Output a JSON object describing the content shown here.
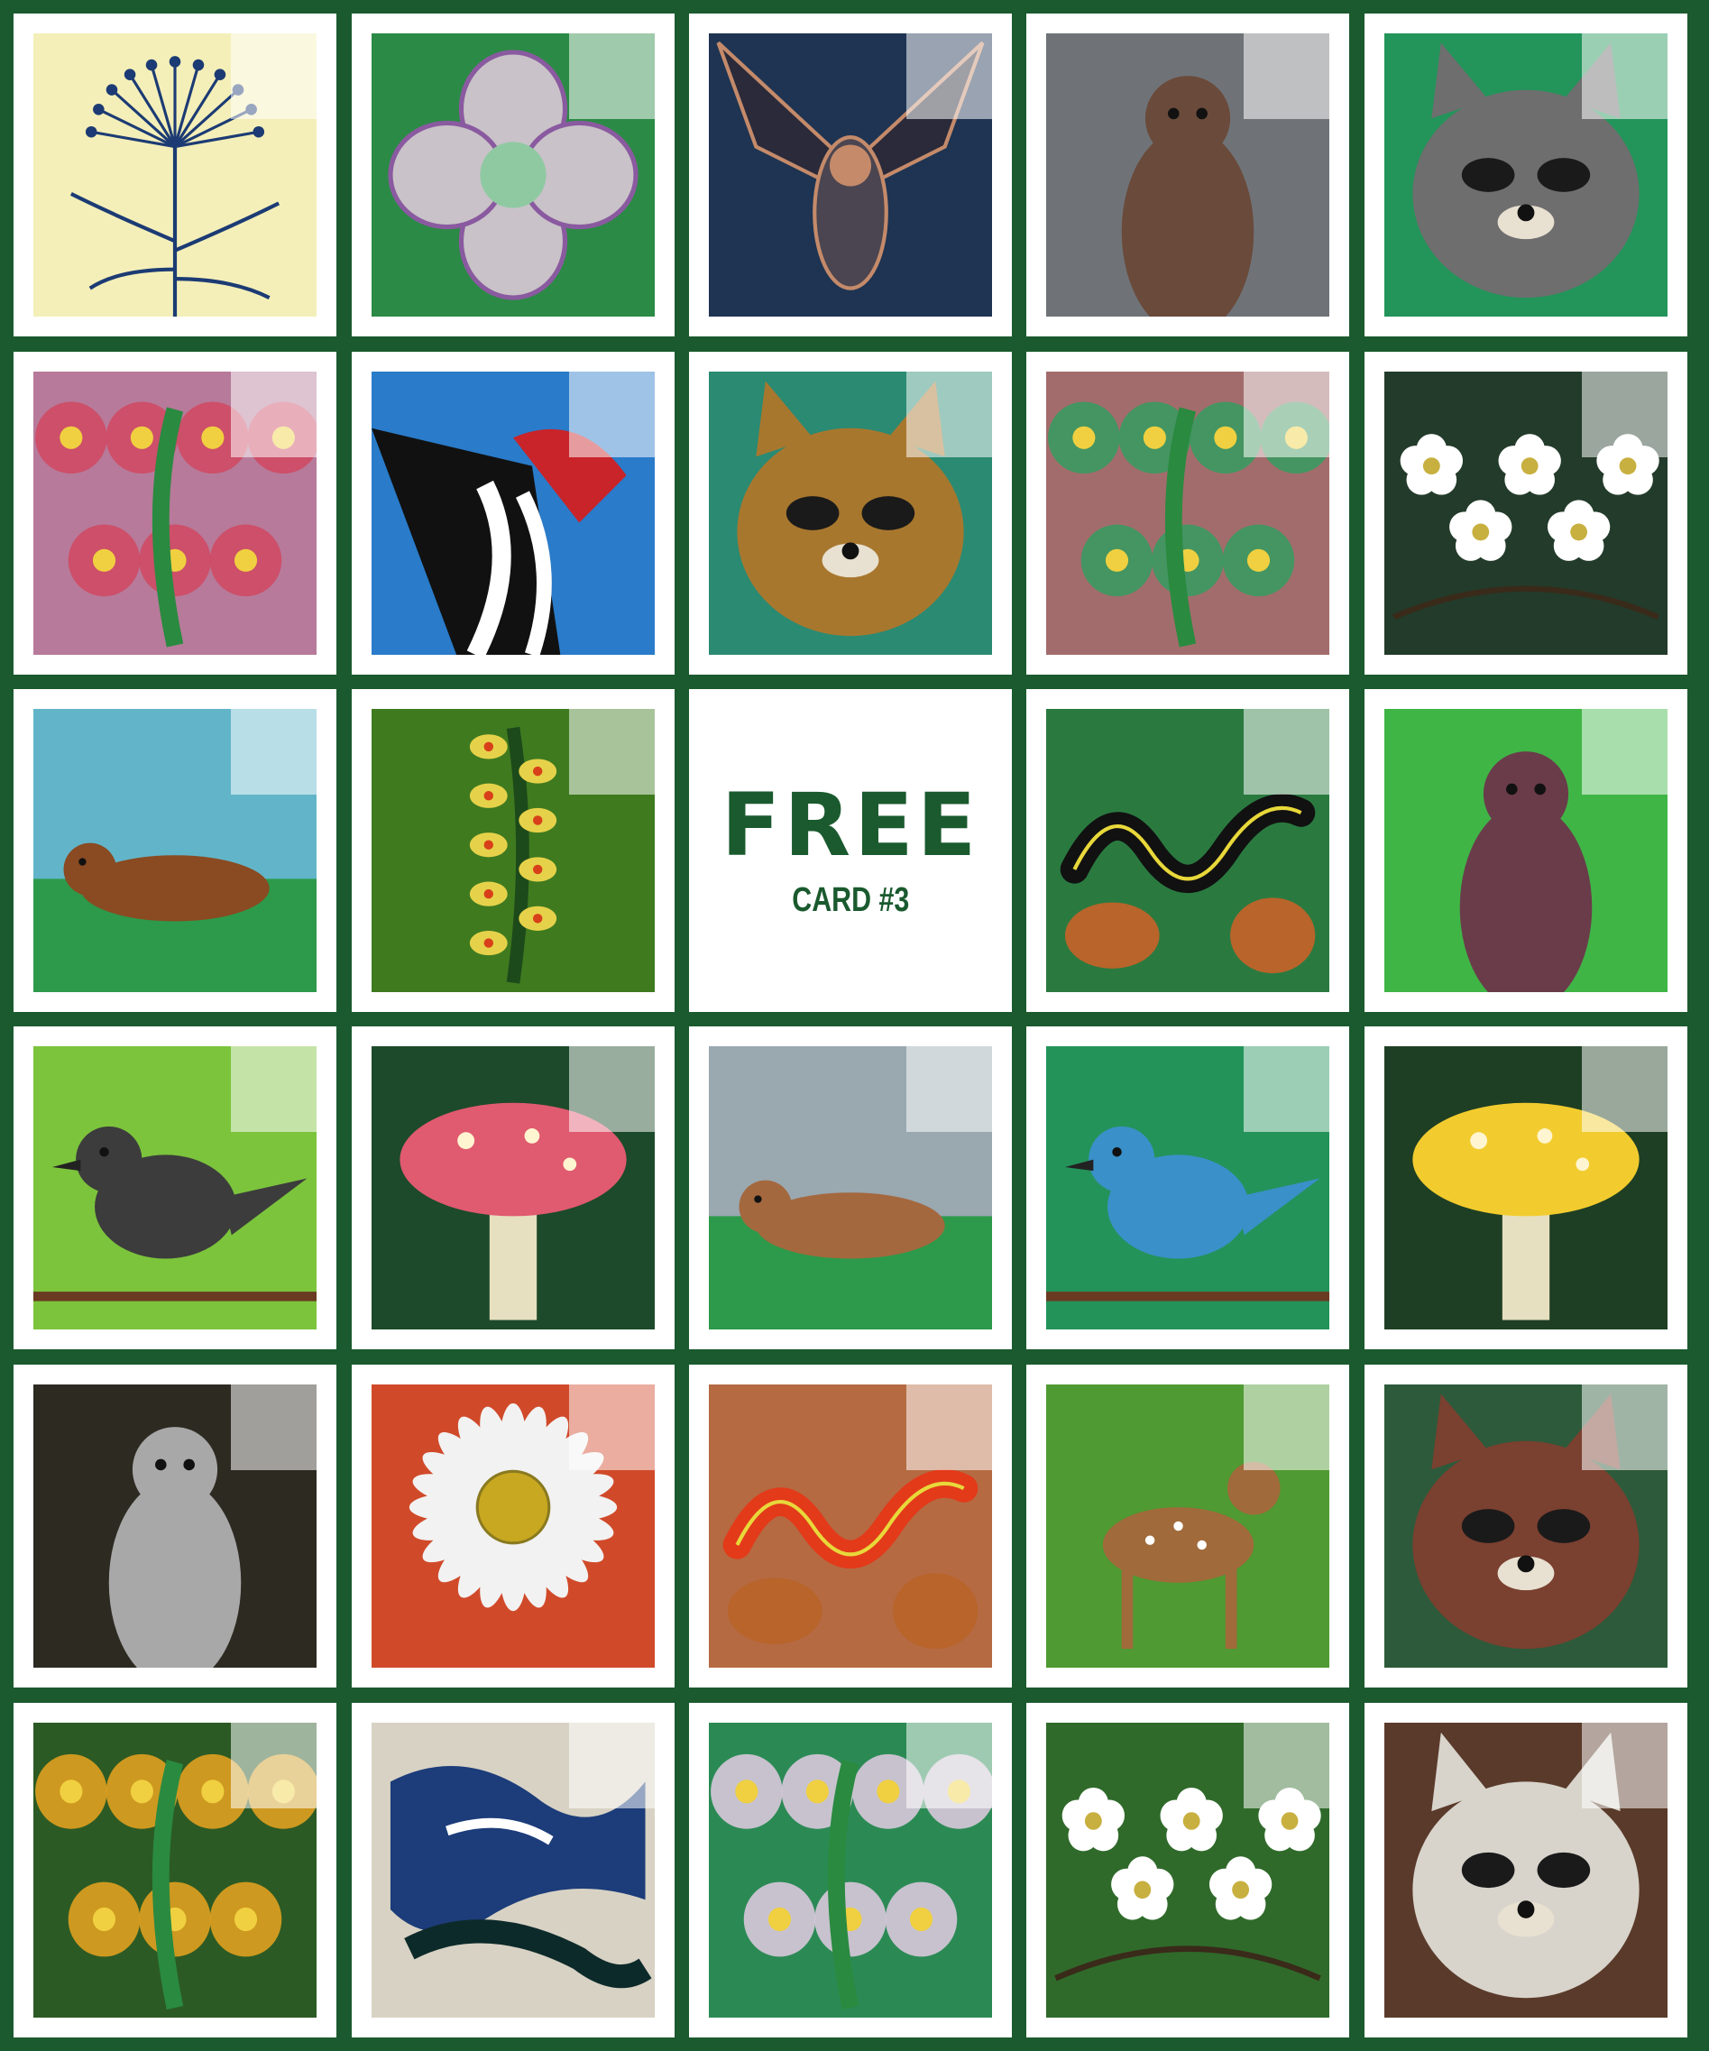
{
  "free_cell": {
    "title": "FREE",
    "subtitle": "CARD #3"
  },
  "colors": {
    "board_green": "#1a5a2e",
    "cell_white": "#ffffff"
  },
  "tiles": [
    {
      "subject": "queen-annes-lace",
      "bg": "#f4efb8",
      "fg": "#1c3b74",
      "shape": "lace"
    },
    {
      "subject": "dogwood-flower",
      "bg": "#2b8a45",
      "fg": "#c9c2c8",
      "shape": "flower4"
    },
    {
      "subject": "bat",
      "bg": "#1e3452",
      "fg": "#c48a6a",
      "shape": "bat"
    },
    {
      "subject": "otter",
      "bg": "#6f7378",
      "fg": "#6a4a3a",
      "shape": "upright"
    },
    {
      "subject": "raccoon",
      "bg": "#23945a",
      "fg": "#6e6e6e",
      "shape": "face"
    },
    {
      "subject": "trillium-bloom",
      "bg": "#b77a9a",
      "fg": "#cf4a64",
      "shape": "blooms"
    },
    {
      "subject": "pileated-woodpecker",
      "bg": "#2a7bc9",
      "fg": "#111111",
      "shape": "bird-head"
    },
    {
      "subject": "fox",
      "bg": "#2b8a72",
      "fg": "#a8772e",
      "shape": "face"
    },
    {
      "subject": "wild-rose",
      "bg": "#a36c6c",
      "fg": "#3a9a60",
      "shape": "blooms"
    },
    {
      "subject": "dogwood-branch",
      "bg": "#233b2a",
      "fg": "#ffffff",
      "shape": "white-flowers"
    },
    {
      "subject": "groundhog",
      "bg": "#62b5c9",
      "fg": "#8a4a22",
      "shape": "lying"
    },
    {
      "subject": "goldenrod",
      "bg": "#3f7a1f",
      "fg": "#e6d24a",
      "shape": "spike"
    },
    {
      "subject": "garter-snake",
      "bg": "#2a7a40",
      "fg": "#111111",
      "shape": "snake"
    },
    {
      "subject": "barred-owl",
      "bg": "#3fb546",
      "fg": "#6a3c4a",
      "shape": "upright"
    },
    {
      "subject": "catbird",
      "bg": "#7cc43c",
      "fg": "#3c3c3c",
      "shape": "perched"
    },
    {
      "subject": "red-mushroom",
      "bg": "#1d4a2a",
      "fg": "#e05a70",
      "shape": "mushroom"
    },
    {
      "subject": "fawn",
      "bg": "#9aa8b0",
      "fg": "#a4683e",
      "shape": "lying"
    },
    {
      "subject": "bluebird",
      "bg": "#23935a",
      "fg": "#3a90c8",
      "shape": "perched"
    },
    {
      "subject": "yellow-mushroom",
      "bg": "#1f3f24",
      "fg": "#f2cc2e",
      "shape": "mushroom"
    },
    {
      "subject": "squirrel",
      "bg": "#2d2a22",
      "fg": "#a8a8a8",
      "shape": "upright"
    },
    {
      "subject": "daisy",
      "bg": "#d04a2a",
      "fg": "#f2f2f2",
      "shape": "daisy"
    },
    {
      "subject": "red-eft",
      "bg": "#b56a42",
      "fg": "#e33a1a",
      "shape": "snake"
    },
    {
      "subject": "white-tailed-deer",
      "bg": "#4f9a32",
      "fg": "#a06a3a",
      "shape": "deer"
    },
    {
      "subject": "buck",
      "bg": "#2d5a3a",
      "fg": "#7a4030",
      "shape": "face"
    },
    {
      "subject": "marsh-marigold",
      "bg": "#2c5a24",
      "fg": "#e0a020",
      "shape": "blooms"
    },
    {
      "subject": "blue-jay",
      "bg": "#d8d2c4",
      "fg": "#1c3c7a",
      "shape": "abstract"
    },
    {
      "subject": "hepatica",
      "bg": "#2b8a54",
      "fg": "#d8c8dc",
      "shape": "blooms"
    },
    {
      "subject": "blackberry-flowers",
      "bg": "#2f6a2a",
      "fg": "#ffffff",
      "shape": "white-flowers"
    },
    {
      "subject": "young-raccoon",
      "bg": "#5a3a2a",
      "fg": "#d8d4cc",
      "shape": "face"
    }
  ]
}
